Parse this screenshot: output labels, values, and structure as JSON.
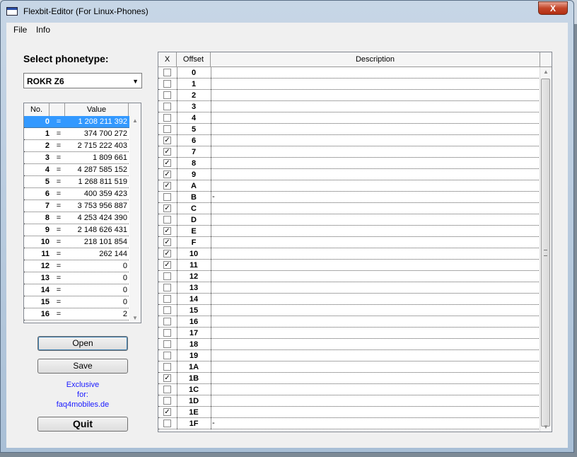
{
  "window": {
    "title": "Flexbit-Editor  (For Linux-Phones)",
    "close_glyph": "X"
  },
  "menu": [
    {
      "label": "File"
    },
    {
      "label": "Info"
    }
  ],
  "phonetype": {
    "label": "Select phonetype:",
    "selected": "ROKR Z6"
  },
  "values_table": {
    "headers": [
      "No.",
      "",
      "Value"
    ],
    "rows": [
      {
        "no": "0",
        "eq": "=",
        "value": "1 208 211 392"
      },
      {
        "no": "1",
        "eq": "=",
        "value": "374 700 272"
      },
      {
        "no": "2",
        "eq": "=",
        "value": "2 715 222 403"
      },
      {
        "no": "3",
        "eq": "=",
        "value": "1 809 661"
      },
      {
        "no": "4",
        "eq": "=",
        "value": "4 287 585 152"
      },
      {
        "no": "5",
        "eq": "=",
        "value": "1 268 811 519"
      },
      {
        "no": "6",
        "eq": "=",
        "value": "400 359 423"
      },
      {
        "no": "7",
        "eq": "=",
        "value": "3 753 956 887"
      },
      {
        "no": "8",
        "eq": "=",
        "value": "4 253 424 390"
      },
      {
        "no": "9",
        "eq": "=",
        "value": "2 148 626 431"
      },
      {
        "no": "10",
        "eq": "=",
        "value": "218 101 854"
      },
      {
        "no": "11",
        "eq": "=",
        "value": "262 144"
      },
      {
        "no": "12",
        "eq": "=",
        "value": "0"
      },
      {
        "no": "13",
        "eq": "=",
        "value": "0"
      },
      {
        "no": "14",
        "eq": "=",
        "value": "0"
      },
      {
        "no": "15",
        "eq": "=",
        "value": "0"
      },
      {
        "no": "16",
        "eq": "=",
        "value": "2"
      }
    ]
  },
  "buttons": {
    "open": "Open",
    "save": "Save",
    "quit": "Quit"
  },
  "exclusive": {
    "line1": "Exclusive",
    "line2": "for:",
    "line3": "faq4mobiles.de"
  },
  "flags_table": {
    "headers": [
      "X",
      "Offset",
      "Description"
    ],
    "check_glyph": "✓",
    "rows": [
      {
        "offset": "0",
        "checked": false,
        "desc": ""
      },
      {
        "offset": "1",
        "checked": false,
        "desc": ""
      },
      {
        "offset": "2",
        "checked": false,
        "desc": ""
      },
      {
        "offset": "3",
        "checked": false,
        "desc": ""
      },
      {
        "offset": "4",
        "checked": false,
        "desc": ""
      },
      {
        "offset": "5",
        "checked": false,
        "desc": ""
      },
      {
        "offset": "6",
        "checked": true,
        "desc": ""
      },
      {
        "offset": "7",
        "checked": true,
        "desc": ""
      },
      {
        "offset": "8",
        "checked": true,
        "desc": ""
      },
      {
        "offset": "9",
        "checked": true,
        "desc": ""
      },
      {
        "offset": "A",
        "checked": true,
        "desc": ""
      },
      {
        "offset": "B",
        "checked": false,
        "desc": "-"
      },
      {
        "offset": "C",
        "checked": true,
        "desc": ""
      },
      {
        "offset": "D",
        "checked": false,
        "desc": ""
      },
      {
        "offset": "E",
        "checked": true,
        "desc": ""
      },
      {
        "offset": "F",
        "checked": true,
        "desc": ""
      },
      {
        "offset": "10",
        "checked": true,
        "desc": ""
      },
      {
        "offset": "11",
        "checked": true,
        "desc": ""
      },
      {
        "offset": "12",
        "checked": false,
        "desc": ""
      },
      {
        "offset": "13",
        "checked": false,
        "desc": ""
      },
      {
        "offset": "14",
        "checked": false,
        "desc": ""
      },
      {
        "offset": "15",
        "checked": false,
        "desc": ""
      },
      {
        "offset": "16",
        "checked": false,
        "desc": ""
      },
      {
        "offset": "17",
        "checked": false,
        "desc": ""
      },
      {
        "offset": "18",
        "checked": false,
        "desc": ""
      },
      {
        "offset": "19",
        "checked": false,
        "desc": ""
      },
      {
        "offset": "1A",
        "checked": false,
        "desc": ""
      },
      {
        "offset": "1B",
        "checked": true,
        "desc": ""
      },
      {
        "offset": "1C",
        "checked": false,
        "desc": ""
      },
      {
        "offset": "1D",
        "checked": false,
        "desc": ""
      },
      {
        "offset": "1E",
        "checked": true,
        "desc": ""
      },
      {
        "offset": "1F",
        "checked": false,
        "desc": "-"
      }
    ]
  }
}
